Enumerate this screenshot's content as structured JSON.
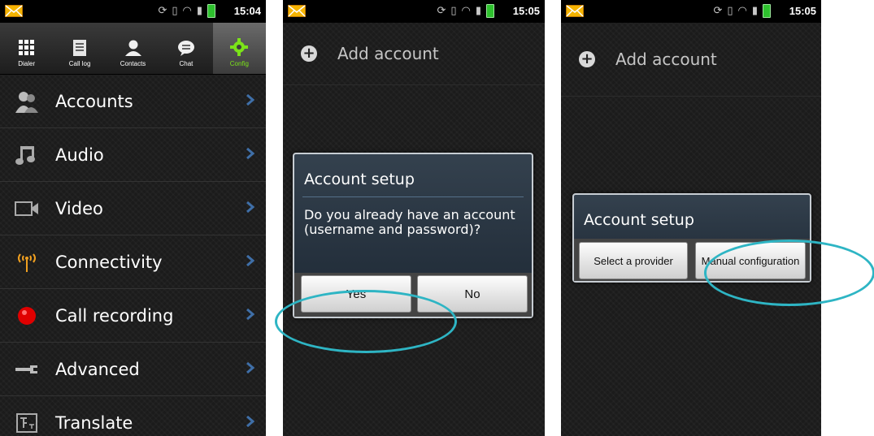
{
  "status_bars": [
    {
      "time": "15:04"
    },
    {
      "time": "15:05"
    },
    {
      "time": "15:05"
    }
  ],
  "tabs": [
    {
      "label": "Dialer",
      "icon": "grid-icon"
    },
    {
      "label": "Call log",
      "icon": "list-icon"
    },
    {
      "label": "Contacts",
      "icon": "person-icon"
    },
    {
      "label": "Chat",
      "icon": "chat-bubble-icon"
    },
    {
      "label": "Config",
      "icon": "gear-icon",
      "active": true
    }
  ],
  "config_menu": [
    {
      "label": "Accounts",
      "icon": "accounts-icon"
    },
    {
      "label": "Audio",
      "icon": "music-note-icon"
    },
    {
      "label": "Video",
      "icon": "video-camera-icon"
    },
    {
      "label": "Connectivity",
      "icon": "antenna-icon"
    },
    {
      "label": "Call recording",
      "icon": "record-icon"
    },
    {
      "label": "Advanced",
      "icon": "wrench-icon"
    },
    {
      "label": "Translate",
      "icon": "translate-icon"
    }
  ],
  "add_account_label": "Add account",
  "dialog_yes_no": {
    "title": "Account setup",
    "message": "Do you already have an account (username and password)?",
    "yes": "Yes",
    "no": "No"
  },
  "dialog_provider": {
    "title": "Account setup",
    "select_provider": "Select a provider",
    "manual_configuration": "Manual configuration"
  },
  "colors": {
    "accent_green": "#7be219",
    "highlight_circle": "#2eb5c4",
    "dialog_bg": "#2a3745"
  }
}
